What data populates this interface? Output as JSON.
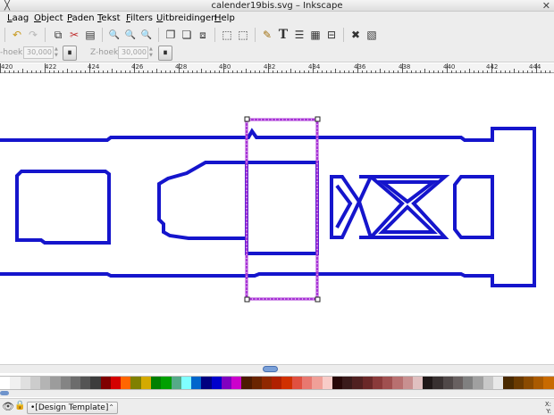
{
  "window": {
    "title": "calender19bis.svg – Inkscape",
    "app_icon": "inkscape-icon",
    "close_glyph": "✕"
  },
  "menu": [
    "Laag",
    "Object",
    "Paden",
    "Tekst",
    "Filters",
    "Uitbreidingen",
    "Help"
  ],
  "commands": [
    {
      "name": "undo-icon",
      "glyph": "↶",
      "enabled": true
    },
    {
      "name": "redo-icon",
      "glyph": "↷",
      "enabled": false
    },
    {
      "name": "copy-icon",
      "glyph": "⧉",
      "enabled": true
    },
    {
      "name": "cut-icon",
      "glyph": "✂",
      "enabled": true
    },
    {
      "name": "paste-icon",
      "glyph": "▤",
      "enabled": true
    },
    {
      "name": "zoom-selection-icon",
      "glyph": "🔍",
      "enabled": true
    },
    {
      "name": "zoom-drawing-icon",
      "glyph": "🔍",
      "enabled": true
    },
    {
      "name": "zoom-page-icon",
      "glyph": "🔍",
      "enabled": true
    },
    {
      "name": "duplicate-icon",
      "glyph": "❐",
      "enabled": true
    },
    {
      "name": "clone-icon",
      "glyph": "❏",
      "enabled": true
    },
    {
      "name": "unlink-clone-icon",
      "glyph": "⧈",
      "enabled": true
    },
    {
      "name": "group-icon",
      "glyph": "⬚",
      "enabled": true
    },
    {
      "name": "ungroup-icon",
      "glyph": "⬚",
      "enabled": true
    },
    {
      "name": "fill-stroke-icon",
      "glyph": "✎",
      "enabled": true
    },
    {
      "name": "text-font-icon",
      "glyph": "T",
      "enabled": true
    },
    {
      "name": "layers-icon",
      "glyph": "☰",
      "enabled": true
    },
    {
      "name": "xml-editor-icon",
      "glyph": "▦",
      "enabled": true
    },
    {
      "name": "align-distribute-icon",
      "glyph": "⊟",
      "enabled": true
    },
    {
      "name": "preferences-icon",
      "glyph": "✖",
      "enabled": true
    },
    {
      "name": "document-properties-icon",
      "glyph": "▧",
      "enabled": true
    }
  ],
  "controls": {
    "y_label": "-hoek:",
    "y_value": "30,000",
    "z_label": "Z-hoek:",
    "z_value": "30,000",
    "toggle_glyph": "⏸"
  },
  "ruler_labels": [
    "420",
    "422",
    "424",
    "426",
    "428",
    "430",
    "432",
    "434",
    "436",
    "438",
    "440",
    "442",
    "444"
  ],
  "palette": [
    "#ffffff",
    "#f0f0f0",
    "#e0e0e0",
    "#cccccc",
    "#b4b4b4",
    "#9c9c9c",
    "#848484",
    "#6c6c6c",
    "#545454",
    "#3c3c3c",
    "#800000",
    "#d40000",
    "#ff6600",
    "#808000",
    "#d4aa00",
    "#008000",
    "#00a000",
    "#55aa88",
    "#80ffff",
    "#0066cc",
    "#000080",
    "#0000cc",
    "#8000c0",
    "#cc00cc",
    "#4d1a00",
    "#6a2400",
    "#902800",
    "#b02000",
    "#d03000",
    "#e05040",
    "#e87870",
    "#f0a098",
    "#f8ccc8",
    "#280808",
    "#3a1a1a",
    "#502020",
    "#6a2828",
    "#8a3a3a",
    "#a05050",
    "#b87070",
    "#c89090",
    "#e0c0c0",
    "#201818",
    "#383030",
    "#504848",
    "#686060",
    "#808080",
    "#a0a0a0",
    "#c8c8c8",
    "#e8e8e8",
    "#4a2a00",
    "#6a3a00",
    "#8a4a00",
    "#aa5a00",
    "#c86a00"
  ],
  "status": {
    "eye_icon": "👁",
    "lock_icon": "🔒",
    "layer": "•[Design Template]",
    "select_arrow": "⌃",
    "x_label": "X:",
    "y_label": "Y:"
  },
  "colors": {
    "stroke": "#1515cc",
    "selection": "#a935d6"
  }
}
